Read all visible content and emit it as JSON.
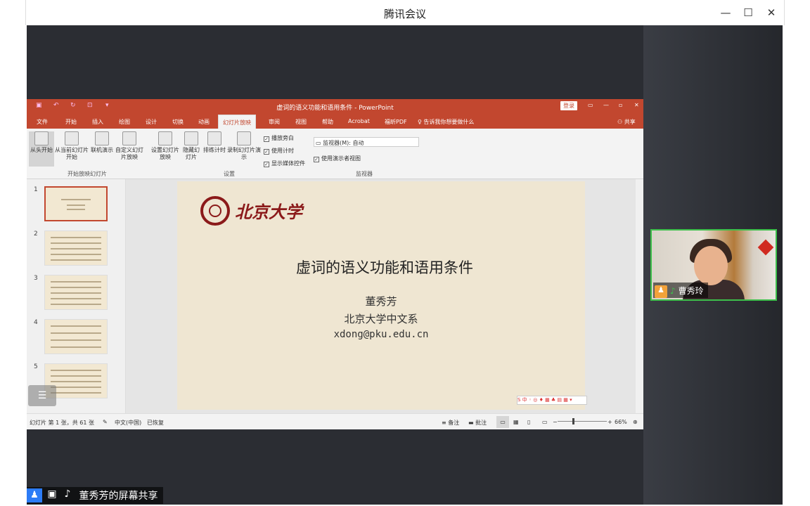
{
  "window": {
    "title": "腾讯会议",
    "controls": {
      "minimize": "—",
      "maximize": "☐",
      "close": "✕"
    }
  },
  "ppt": {
    "title": "虚词的语义功能和语用条件  -  PowerPoint",
    "login": "登录",
    "share_label": "共享",
    "tabs": [
      "文件",
      "开始",
      "插入",
      "绘图",
      "设计",
      "切换",
      "动画",
      "幻灯片放映",
      "审阅",
      "视图",
      "帮助",
      "Acrobat",
      "福昕PDF"
    ],
    "tell_me": "告诉我你想要做什么",
    "ribbon": {
      "from_start": "从头开始",
      "from_current": "从当前幻灯片开始",
      "online": "联机演示",
      "custom": "自定义幻灯片放映",
      "group1": "开始放映幻灯片",
      "setup": "设置幻灯片放映",
      "hide": "隐藏幻灯片",
      "rehearse": "排练计时",
      "record": "录制幻灯片演示",
      "chk_narration": "播放旁白",
      "chk_timing": "使用计时",
      "chk_media": "显示媒体控件",
      "group2": "设置",
      "monitor": "监视器(M): 自动",
      "presenter_view": "使用演示者视图",
      "group3": "监视器"
    },
    "thumb_numbers": [
      "1",
      "2",
      "3",
      "4",
      "5"
    ],
    "slide": {
      "logo_text": "北京大学",
      "title": "虚词的语义功能和语用条件",
      "author": "董秀芳",
      "dept": "北京大学中文系",
      "email": "xdong@pku.edu.cn",
      "number": "1"
    },
    "status": {
      "slide_info": "幻灯片 第 1 张，共 61 张",
      "language": "中文(中国)",
      "recovered": "已恢复",
      "notes": "备注",
      "comments": "批注",
      "zoom": "66%"
    }
  },
  "video": {
    "name": "曹秀玲"
  },
  "bottombar": {
    "label": "董秀芳的屏幕共享"
  }
}
